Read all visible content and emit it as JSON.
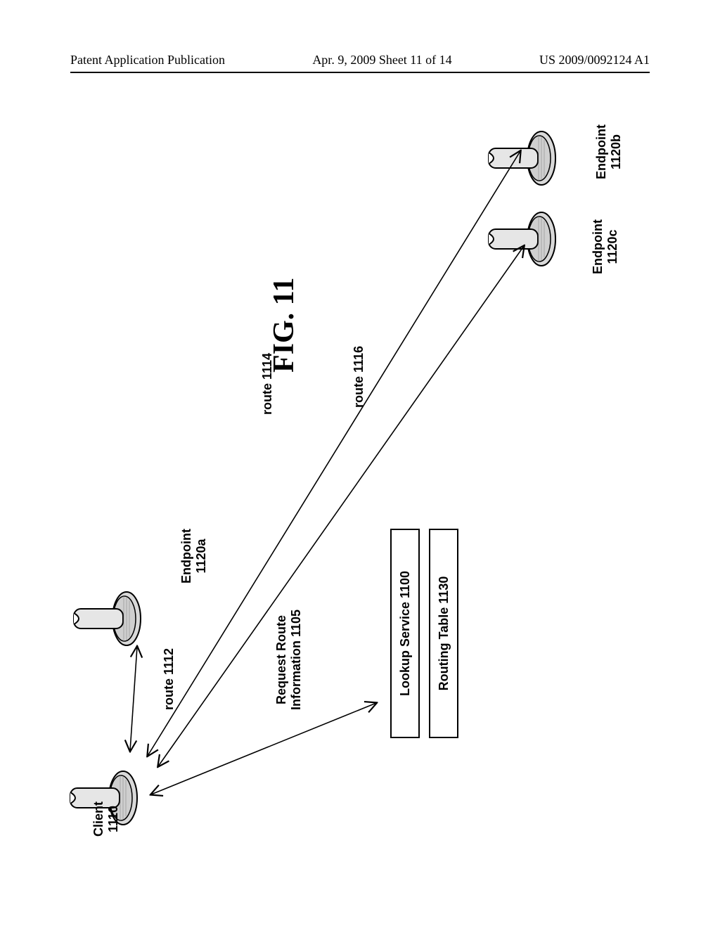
{
  "header": {
    "left": "Patent Application Publication",
    "center": "Apr. 9, 2009  Sheet 11 of 14",
    "right": "US 2009/0092124 A1"
  },
  "figure_title": "FIG. 11",
  "labels": {
    "endpoint_a": "Endpoint\n1120a",
    "endpoint_b": "Endpoint\n1120b",
    "endpoint_c": "Endpoint\n1120c",
    "client": "Client\n1110",
    "route_1112": "route 1112",
    "route_1114": "route 1114",
    "route_1116": "route 1116",
    "request_route": "Request Route\nInformation 1105",
    "lookup_service": "Lookup Service 1100",
    "routing_table": "Routing Table 1130"
  }
}
